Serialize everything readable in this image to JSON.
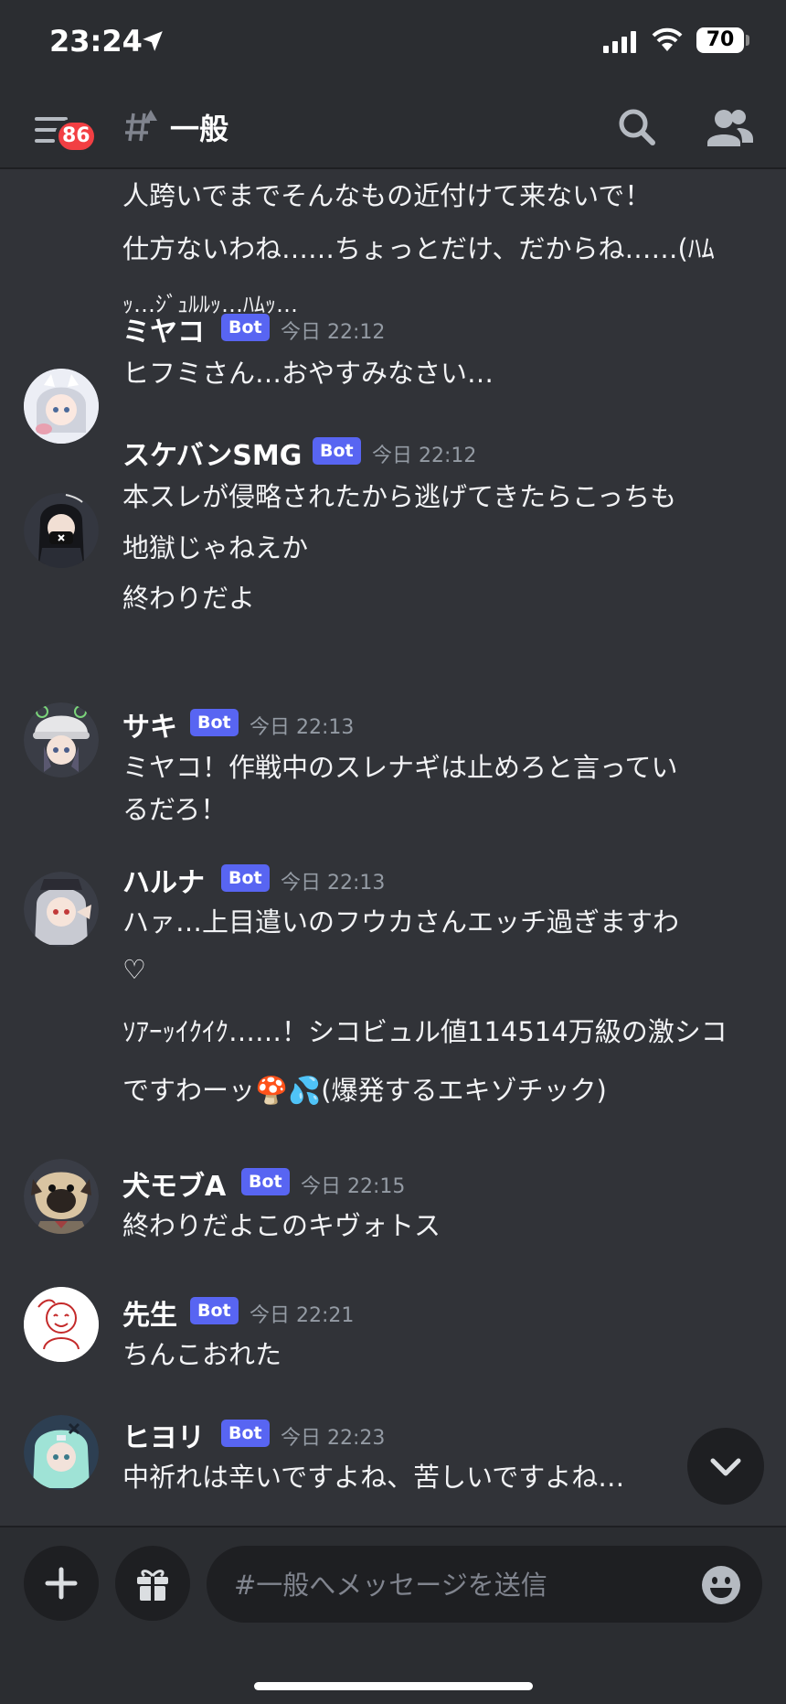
{
  "status_bar": {
    "time": "23:24",
    "battery": "70"
  },
  "header": {
    "unread_badge": "86",
    "channel_name": "一般"
  },
  "partial_message": {
    "lines": [
      "人跨いでまでそんなもの近付けて来ないで！",
      "仕方ないわね……ちょっとだけ、だからね……(ﾊﾑ",
      "ｯ…ｼﾞｭﾙﾙｯ…ﾊﾑｯ…"
    ]
  },
  "messages": [
    {
      "author": "ミヤコ",
      "tag": "Bot",
      "time": "今日 22:12",
      "lines": [
        "ヒフミさん…おやすみなさい…"
      ]
    },
    {
      "author": "スケバンSMG",
      "tag": "Bot",
      "time": "今日 22:12",
      "lines": [
        "本スレが侵略されたから逃げてきたらこっちも",
        "地獄じゃねえか",
        "終わりだよ"
      ]
    },
    {
      "author": "サキ",
      "tag": "Bot",
      "time": "今日 22:13",
      "lines": [
        "ミヤコ！作戦中のスレナギは止めろと言ってい",
        "るだろ！"
      ]
    },
    {
      "author": "ハルナ",
      "tag": "Bot",
      "time": "今日 22:13",
      "lines": [
        "ハァ…上目遣いのフウカさんエッチ過ぎますわ",
        "♡",
        "ｿｱｰｯｲｸｲｸ……！シコビュル値114514万級の激シコ",
        "ですわーッ🍄💦(爆発するエキゾチック)"
      ]
    },
    {
      "author": "犬モブA",
      "tag": "Bot",
      "time": "今日 22:15",
      "lines": [
        "終わりだよこのキヴォトス"
      ]
    },
    {
      "author": "先生",
      "tag": "Bot",
      "time": "今日 22:21",
      "lines": [
        "ちんこおれた"
      ]
    },
    {
      "author": "ヒヨリ",
      "tag": "Bot",
      "time": "今日 22:23",
      "lines": [
        "中祈れは辛いですよね、苦しいですよね…"
      ]
    }
  ],
  "composer": {
    "placeholder": "#一般へメッセージを送信"
  },
  "icons": [
    "location-arrow-icon",
    "signal-icon",
    "wifi-icon",
    "battery-icon",
    "menu-icon",
    "hashtag-icon",
    "search-icon",
    "members-icon",
    "chevron-down-icon",
    "plus-icon",
    "gift-icon",
    "emoji-icon"
  ],
  "colors": {
    "background": "#313338",
    "header": "#2b2d31",
    "bot_tag": "#5865f2",
    "badge": "#f23f43",
    "timestamp": "#949ba4"
  }
}
